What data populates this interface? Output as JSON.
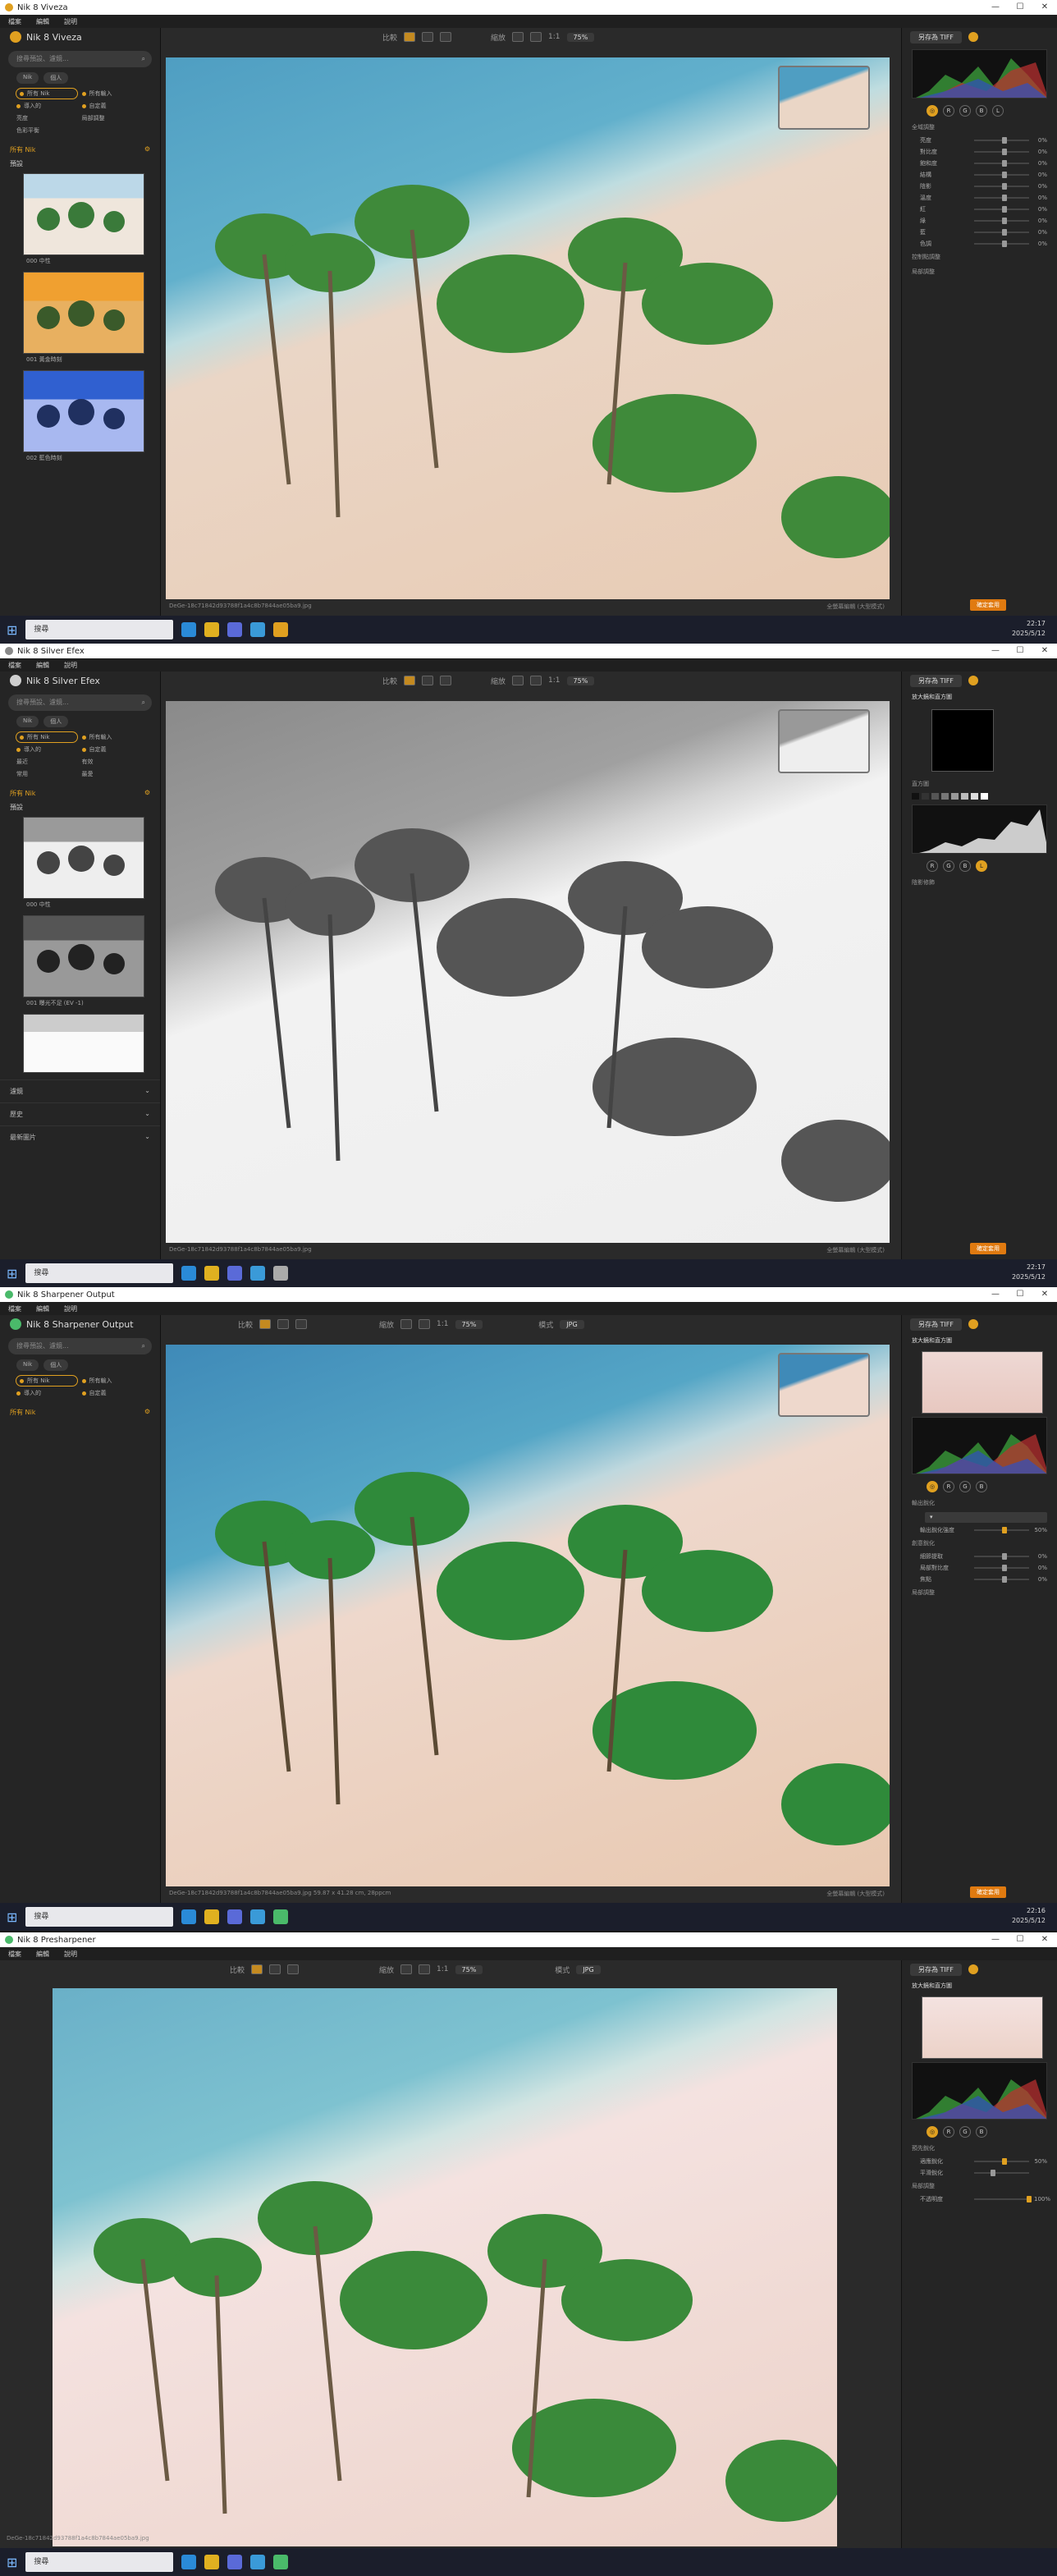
{
  "menu": [
    "檔案",
    "編輯",
    "說明"
  ],
  "search_placeholder": "搜尋預設、濾鏡...",
  "pills": [
    "Nik",
    "個人"
  ],
  "filters": [
    "所有 Nik",
    "所有輸入",
    "導入的",
    "自定義",
    "常用"
  ],
  "filters_extra": [
    "最近",
    "有效",
    "最愛"
  ],
  "nik_label": "所有 Nik",
  "presets_label": "預設",
  "accordions": [
    "濾鏡",
    "歷史",
    "最新圖片"
  ],
  "toolbar": {
    "compare": "比較",
    "zoom": "縮放",
    "zoom_value": "75%",
    "mode": "模式",
    "mode_value": "JPG"
  },
  "save_as": "另存為 TIFF",
  "apply": "確定套用",
  "taskbar": {
    "search": "搜尋",
    "time1": "22:17",
    "time2": "22:16",
    "date": "2025/5/12"
  },
  "windows": [
    {
      "title": "Nik 8 Viveza",
      "logo_color": "#e0a020",
      "status_left": "DeGe-18c71842d93788f1a4c8b7844ae05ba9.jpg",
      "status_right": "全螢幕編輯 (大型模式)",
      "filter_bottom": "色彩平衡",
      "presets": [
        "000 中性",
        "001 黃金時刻",
        "002 藍色時刻"
      ],
      "sections": [
        "全域調整",
        "控制點調整",
        "局部調整"
      ],
      "sliders": [
        "亮度",
        "對比度",
        "飽和度",
        "結構",
        "陰影",
        "溫度",
        "紅",
        "綠",
        "藍",
        "色調"
      ]
    },
    {
      "title": "Nik 8 Silver Efex",
      "logo_color": "#cfcfcf",
      "status_left": "DeGe-18c71842d93788f1a4c8b7844ae05ba9.jpg",
      "status_right": "全螢幕編輯 (大型模式)",
      "presets": [
        "000 中性",
        "001 曝光不足 (EV -1)"
      ],
      "sections": [
        "放大鏡和直方圖",
        "直方圖",
        "陰影修飾"
      ],
      "sliders": []
    },
    {
      "title": "Nik 8 Sharpener Output",
      "logo_color": "#4aba6a",
      "status_left": "DeGe-18c71842d93788f1a4c8b7844ae05ba9.jpg     59.87 x 41.28 cm, 28ppcm",
      "status_right": "全螢幕編輯 (大型模式)",
      "sections": [
        "放大鏡和直方圖",
        "輸出銳化",
        "創意銳化",
        "局部調整"
      ],
      "sliders": [
        "輸出銳化強度",
        "細節提取",
        "局部對比度",
        "焦點"
      ]
    },
    {
      "title": "Nik 8 Presharpener",
      "logo_color": "#4aba6a",
      "status_left": "DeGe-18c71842d93788f1a4c8b7844ae05ba9.jpg",
      "status_right": "",
      "sections": [
        "放大鏡和直方圖",
        "預先銳化",
        "局部調整"
      ],
      "sliders": [
        "適應銳化",
        "平滑銳化",
        "不透明度"
      ]
    }
  ]
}
